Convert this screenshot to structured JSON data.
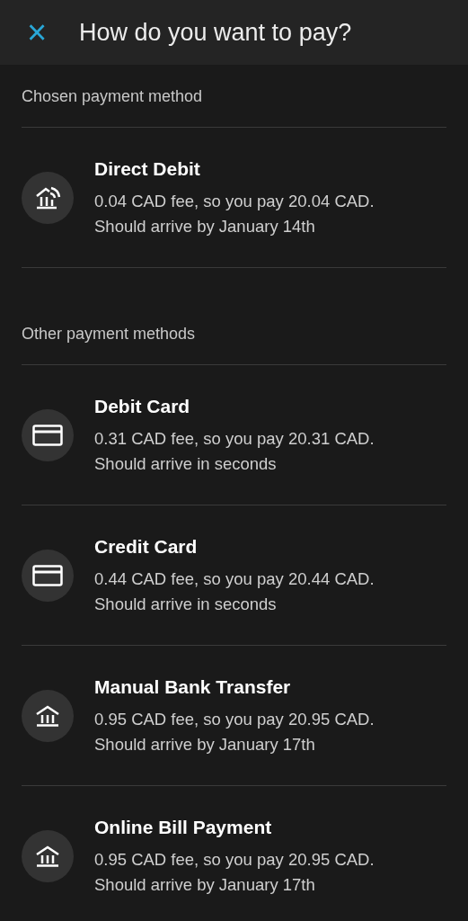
{
  "header": {
    "close": "×",
    "title": "How do you want to pay?"
  },
  "sections": [
    {
      "heading": "Chosen payment method",
      "methods": [
        {
          "kind": "direct",
          "name": "Direct Debit",
          "fee": "0.04 CAD fee, so you pay 20.04 CAD.",
          "arrival": "Should arrive by January 14th"
        }
      ]
    },
    {
      "heading": "Other payment methods",
      "methods": [
        {
          "kind": "card",
          "name": "Debit Card",
          "fee": "0.31 CAD fee, so you pay 20.31 CAD.",
          "arrival": "Should arrive in seconds"
        },
        {
          "kind": "card",
          "name": "Credit Card",
          "fee": "0.44 CAD fee, so you pay 20.44 CAD.",
          "arrival": "Should arrive in seconds"
        },
        {
          "kind": "bank",
          "name": "Manual Bank Transfer",
          "fee": "0.95 CAD fee, so you pay 20.95 CAD.",
          "arrival": "Should arrive by January 17th"
        },
        {
          "kind": "bank",
          "name": "Online Bill Payment",
          "fee": "0.95 CAD fee, so you pay 20.95 CAD.",
          "arrival": "Should arrive by January 17th"
        }
      ]
    }
  ]
}
